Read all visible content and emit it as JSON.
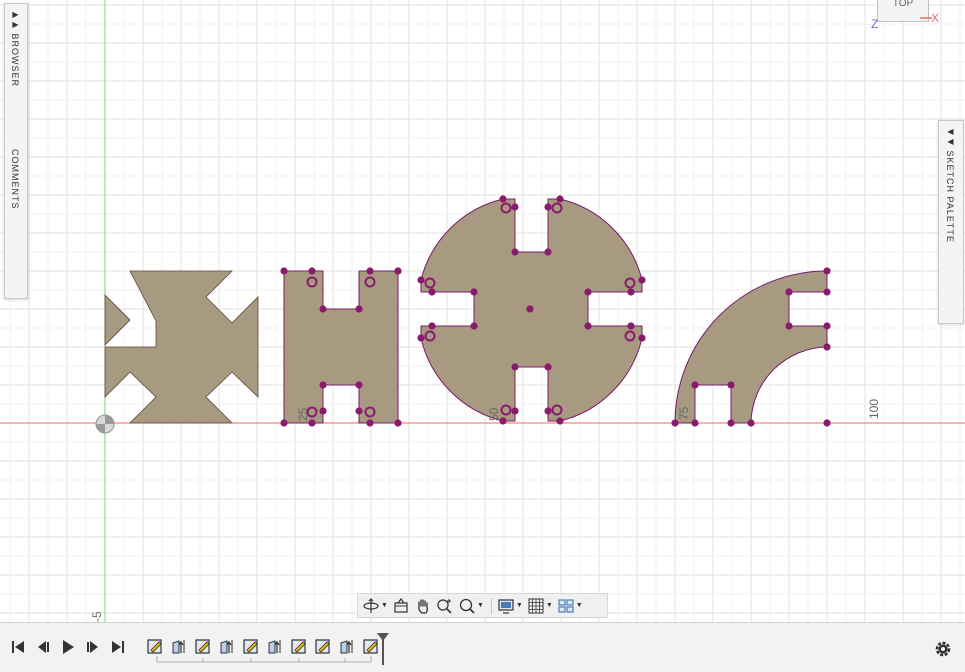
{
  "left_panel": {
    "browser_label": "BROWSER",
    "comments_label": "COMMENTS",
    "collapse_glyph": "▶▶"
  },
  "right_panel": {
    "sketch_palette_label": "SKETCH PALETTE",
    "expand_glyph": "◀◀"
  },
  "viewcube": {
    "face_label": "TOP"
  },
  "axes": {
    "x_label": "X",
    "z_label": "Z"
  },
  "dimensions": [
    "25",
    "50",
    "75",
    "100",
    "-5"
  ],
  "colors": {
    "profile_fill": "#a89a80",
    "profile_edge": "#7a1a6a",
    "sketch_point": "#8a1a6e",
    "x_axis": "#f06a6a",
    "y_axis": "#7fd07f",
    "grid_major": "#e0e0e0",
    "grid_minor": "#f0f0f0"
  },
  "nav_toolbar": {
    "buttons": [
      "orbit-icon",
      "look-at-icon",
      "pan-icon",
      "zoom-icon",
      "fit-icon",
      "display-settings-icon",
      "grid-settings-icon",
      "viewports-icon"
    ]
  },
  "timeline": {
    "playback": [
      "go-to-start-icon",
      "step-back-icon",
      "play-icon",
      "step-forward-icon",
      "go-to-end-icon"
    ],
    "features": [
      "sketch",
      "extrude",
      "sketch",
      "extrude",
      "sketch",
      "extrude",
      "sketch",
      "sketch",
      "extrude",
      "sketch"
    ],
    "settings_icon": "gear-icon"
  }
}
